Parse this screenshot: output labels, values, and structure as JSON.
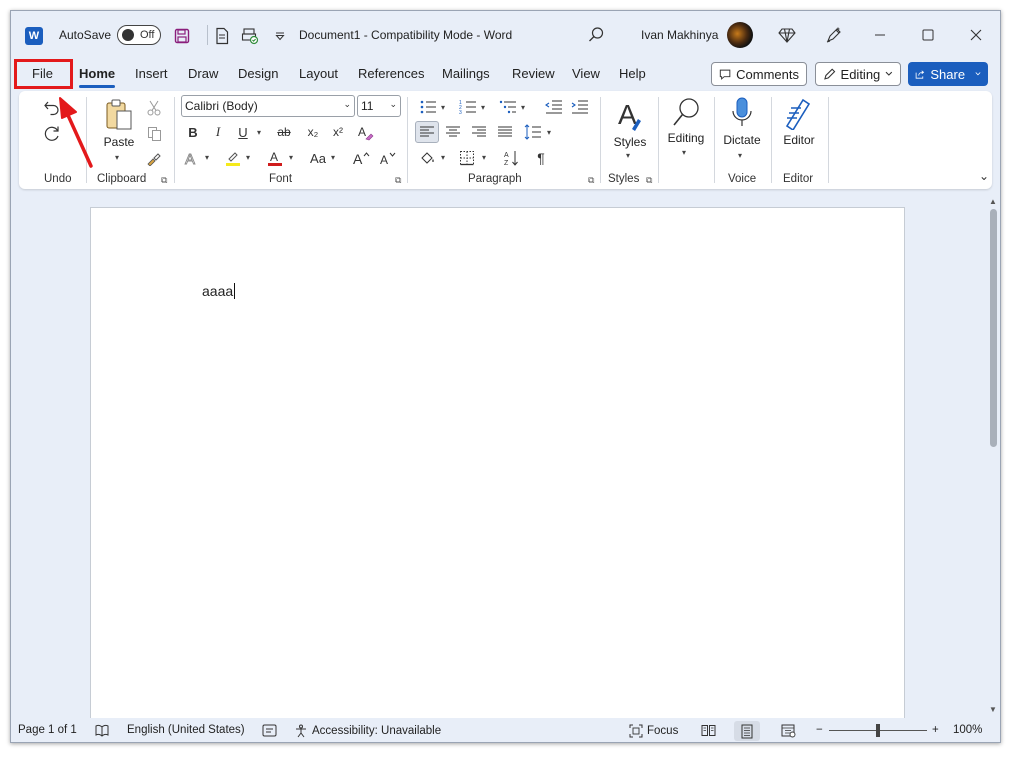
{
  "titlebar": {
    "app_logo": "W",
    "autosave_label": "AutoSave",
    "autosave_state": "Off",
    "doc_title": "Document1  -  Compatibility Mode  -  Word",
    "user_name": "Ivan Makhinya",
    "icons": [
      "word-logo-icon",
      "save-icon",
      "new-document-icon",
      "print-preview-icon",
      "customize-toolbar-icon",
      "search-icon",
      "diamond-premium-icon",
      "designer-pen-icon",
      "minimize-icon",
      "maximize-icon",
      "close-icon"
    ]
  },
  "tabs": [
    "File",
    "Home",
    "Insert",
    "Draw",
    "Design",
    "Layout",
    "References",
    "Mailings",
    "Review",
    "View",
    "Help"
  ],
  "active_tab": "Home",
  "tab_actions": {
    "comments": "Comments",
    "editing": "Editing",
    "share": "Share"
  },
  "ribbon": {
    "groups": {
      "undo": "Undo",
      "clipboard": "Clipboard",
      "font": "Font",
      "paragraph": "Paragraph",
      "styles": "Styles",
      "voice": "Voice",
      "editor": "Editor"
    },
    "paste_label": "Paste",
    "font_name": "Calibri (Body)",
    "font_size": "11",
    "styles_label": "Styles",
    "editing_label": "Editing",
    "dictate_label": "Dictate",
    "editor_label": "Editor",
    "font_buttons": {
      "bold": "B",
      "italic": "I",
      "underline": "U",
      "strike": "ab",
      "subscript": "x₂",
      "superscript": "x²",
      "change_case": "Aa",
      "grow": "A^",
      "shrink": "A˅",
      "pilcrow": "¶"
    }
  },
  "document": {
    "body_text": "aaaa"
  },
  "statusbar": {
    "page": "Page 1 of 1",
    "language": "English (United States)",
    "accessibility": "Accessibility: Unavailable",
    "focus": "Focus",
    "zoom": "100%",
    "zoom_minus": "−",
    "zoom_plus": "+"
  },
  "colors": {
    "accent": "#1b5ebe",
    "highlight_box": "#e3191b",
    "chrome_bg": "#e8eef8"
  }
}
